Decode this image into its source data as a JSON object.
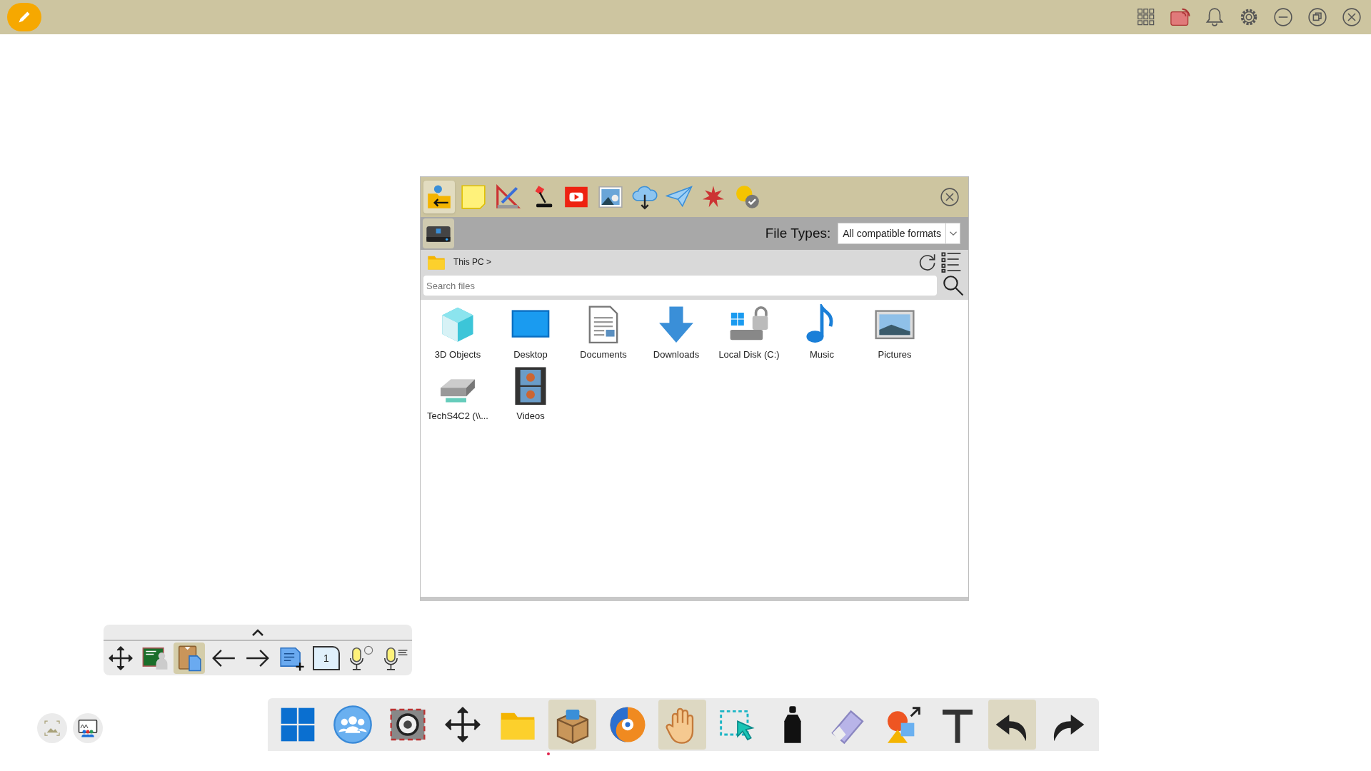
{
  "top_bar": {
    "buttons": [
      {
        "kind": "apps"
      },
      {
        "kind": "cast"
      },
      {
        "kind": "bell"
      },
      {
        "kind": "gear"
      },
      {
        "kind": "minimize"
      },
      {
        "kind": "restore"
      },
      {
        "kind": "close"
      }
    ]
  },
  "dialog": {
    "tabs": [
      {
        "kind": "import",
        "selected": true
      },
      {
        "kind": "note",
        "selected": false
      },
      {
        "kind": "ruler",
        "selected": false
      },
      {
        "kind": "lamp",
        "selected": false
      },
      {
        "kind": "video",
        "selected": false
      },
      {
        "kind": "image",
        "selected": false
      },
      {
        "kind": "cloud",
        "selected": false
      },
      {
        "kind": "plane",
        "selected": false
      },
      {
        "kind": "fireworks",
        "selected": false
      },
      {
        "kind": "help",
        "selected": false
      }
    ],
    "file_types": {
      "label": "File Types:",
      "value": "All compatible formats"
    },
    "path": {
      "crumb": "This PC >"
    },
    "search": {
      "placeholder": "Search files"
    },
    "items": [
      {
        "name": "3D Objects",
        "kind": "cube"
      },
      {
        "name": "Desktop",
        "kind": "desktop"
      },
      {
        "name": "Documents",
        "kind": "document"
      },
      {
        "name": "Downloads",
        "kind": "download"
      },
      {
        "name": "Local Disk (C:)",
        "kind": "disk"
      },
      {
        "name": "Music",
        "kind": "music"
      },
      {
        "name": "Pictures",
        "kind": "picture"
      },
      {
        "name": "TechS4C2 (\\\\...",
        "kind": "network"
      },
      {
        "name": "Videos",
        "kind": "film"
      }
    ]
  },
  "page_toolbar": {
    "items": [
      {
        "kind": "move",
        "selected": false
      },
      {
        "kind": "teacher",
        "selected": false
      },
      {
        "kind": "clipboard",
        "selected": true
      },
      {
        "kind": "back",
        "selected": false
      },
      {
        "kind": "forward",
        "selected": false
      },
      {
        "kind": "addpage",
        "selected": false
      },
      {
        "kind": "page",
        "label": "1",
        "selected": false
      },
      {
        "kind": "micglobe",
        "selected": false
      },
      {
        "kind": "miclines",
        "selected": false
      }
    ]
  },
  "corner_buttons": [
    {
      "kind": "frame"
    },
    {
      "kind": "board"
    }
  ],
  "main_toolbar": {
    "items": [
      {
        "kind": "windows",
        "selected": false
      },
      {
        "kind": "people",
        "selected": false
      },
      {
        "kind": "shutter",
        "selected": false
      },
      {
        "kind": "move",
        "selected": false
      },
      {
        "kind": "folder",
        "selected": false
      },
      {
        "kind": "box",
        "selected": true,
        "indicator": true
      },
      {
        "kind": "browser",
        "selected": false
      },
      {
        "kind": "hand",
        "selected": true
      },
      {
        "kind": "select",
        "selected": false
      },
      {
        "kind": "marker",
        "selected": false
      },
      {
        "kind": "eraser",
        "selected": false
      },
      {
        "kind": "shapes",
        "selected": false
      },
      {
        "kind": "text",
        "selected": false
      },
      {
        "kind": "undo",
        "selected": true
      },
      {
        "kind": "redo",
        "selected": false
      }
    ]
  }
}
